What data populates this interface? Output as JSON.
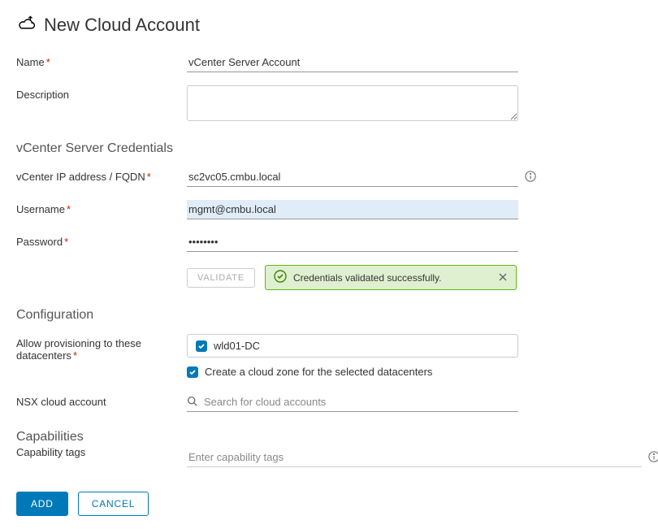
{
  "header": {
    "title": "New Cloud Account"
  },
  "fields": {
    "name": {
      "label": "Name",
      "value": "vCenter Server Account",
      "required": true
    },
    "description": {
      "label": "Description",
      "value": ""
    }
  },
  "credentials": {
    "heading": "vCenter Server Credentials",
    "ip": {
      "label": "vCenter IP address / FQDN",
      "value": "sc2vc05.cmbu.local",
      "required": true
    },
    "username": {
      "label": "Username",
      "value": "mgmt@cmbu.local",
      "required": true
    },
    "password": {
      "label": "Password",
      "value": "••••••••",
      "required": true
    },
    "validate_label": "VALIDATE",
    "success_message": "Credentials validated successfully."
  },
  "configuration": {
    "heading": "Configuration",
    "datacenters": {
      "label": "Allow provisioning to these datacenters",
      "selected": "wld01-DC",
      "required": true
    },
    "create_zone_label": "Create a cloud zone for the selected datacenters",
    "nsx": {
      "label": "NSX cloud account",
      "placeholder": "Search for cloud accounts"
    }
  },
  "capabilities": {
    "heading": "Capabilities",
    "tags": {
      "label": "Capability tags",
      "placeholder": "Enter capability tags"
    }
  },
  "footer": {
    "add_label": "ADD",
    "cancel_label": "CANCEL"
  }
}
